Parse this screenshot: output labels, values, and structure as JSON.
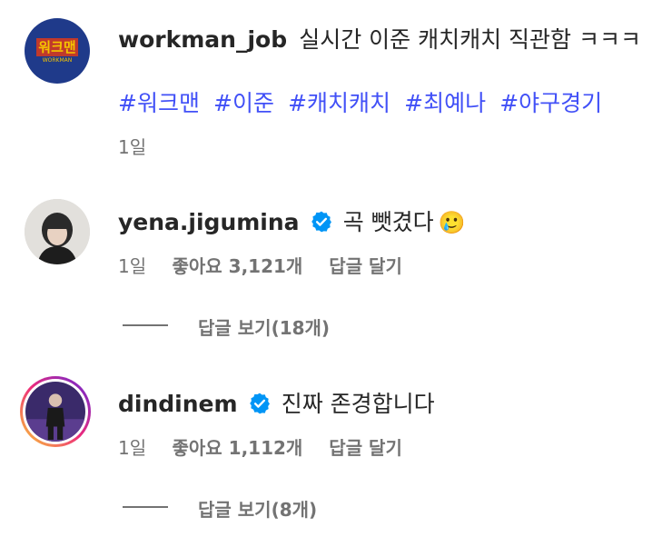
{
  "comments": [
    {
      "username": "workman_job",
      "text": "실시간 이준 캐치캐치 직관함 ㅋㅋㅋ",
      "hashtags": [
        "#워크맨",
        "#이준",
        "#캐치캐치",
        "#최예나",
        "#야구경기"
      ],
      "time": "1일",
      "avatar_text": "워크맨",
      "avatar_sub": "WORKMAN"
    },
    {
      "username": "yena.jigumina",
      "verified": true,
      "text": "곡 뺏겼다",
      "emoji": "🥲",
      "time": "1일",
      "likes_label": "좋아요",
      "likes": "3,121개",
      "reply_label": "답글 달기",
      "view_replies": "답글 보기(18개)"
    },
    {
      "username": "dindinem",
      "verified": true,
      "text": "진짜 존경합니다",
      "time": "1일",
      "likes_label": "좋아요",
      "likes": "1,112개",
      "reply_label": "답글 달기",
      "view_replies": "답글 보기(8개)"
    }
  ],
  "colors": {
    "hashtag": "#4150f7",
    "verified": "#0095f6",
    "meta": "#737373",
    "text": "#262626"
  }
}
